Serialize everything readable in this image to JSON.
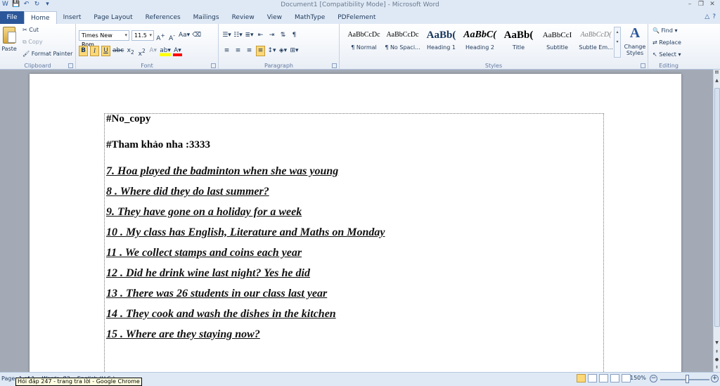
{
  "window": {
    "title": "Document1 [Compatibility Mode] - Microsoft Word"
  },
  "tabs": [
    "File",
    "Home",
    "Insert",
    "Page Layout",
    "References",
    "Mailings",
    "Review",
    "View",
    "MathType",
    "PDFelement"
  ],
  "active_tab": "Home",
  "clipboard": {
    "paste": "Paste",
    "cut": "Cut",
    "copy": "Copy",
    "format_painter": "Format Painter",
    "label": "Clipboard"
  },
  "font": {
    "name": "Times New Rom",
    "size": "11.5",
    "label": "Font",
    "bold": "B",
    "italic": "I",
    "underline": "U"
  },
  "paragraph": {
    "label": "Paragraph"
  },
  "styles": {
    "label": "Styles",
    "items": [
      {
        "preview": "AaBbCcDc",
        "name": "¶ Normal"
      },
      {
        "preview": "AaBbCcDc",
        "name": "¶ No Spaci..."
      },
      {
        "preview": "AaBb(",
        "name": "Heading 1"
      },
      {
        "preview": "AaBbC(",
        "name": "Heading 2"
      },
      {
        "preview": "AaBb(",
        "name": "Title"
      },
      {
        "preview": "AaBbCcI",
        "name": "Subtitle"
      },
      {
        "preview": "AaBbCcD(",
        "name": "Subtle Em..."
      }
    ],
    "change_styles": "Change Styles"
  },
  "editing": {
    "label": "Editing",
    "find": "Find",
    "replace": "Replace",
    "select": "Select"
  },
  "document": {
    "headings": [
      "#No_copy",
      "#Tham khảo nha :3333"
    ],
    "lines": [
      "7. Hoa played the badminton when she was young",
      "8 . Where did they do last summer?",
      "9. They have gone on a holiday for a week",
      "10 . My class has English, Literature and Maths on Monday",
      "11 . We collect stamps and coins each year",
      "12 . Did he drink wine last night?  Yes he did",
      "13 . There was 26 students in our class last year",
      "14 . They cook and wash the dishes in the kitchen",
      "15 . Where are they staying now?"
    ]
  },
  "status": {
    "page": "Page: 1 of 1",
    "words": "Words: 83",
    "language": "English (U.S.)",
    "zoom": "150%",
    "tooltip": "Hỏi đáp 247 - trang tra lời - Google Chrome"
  }
}
